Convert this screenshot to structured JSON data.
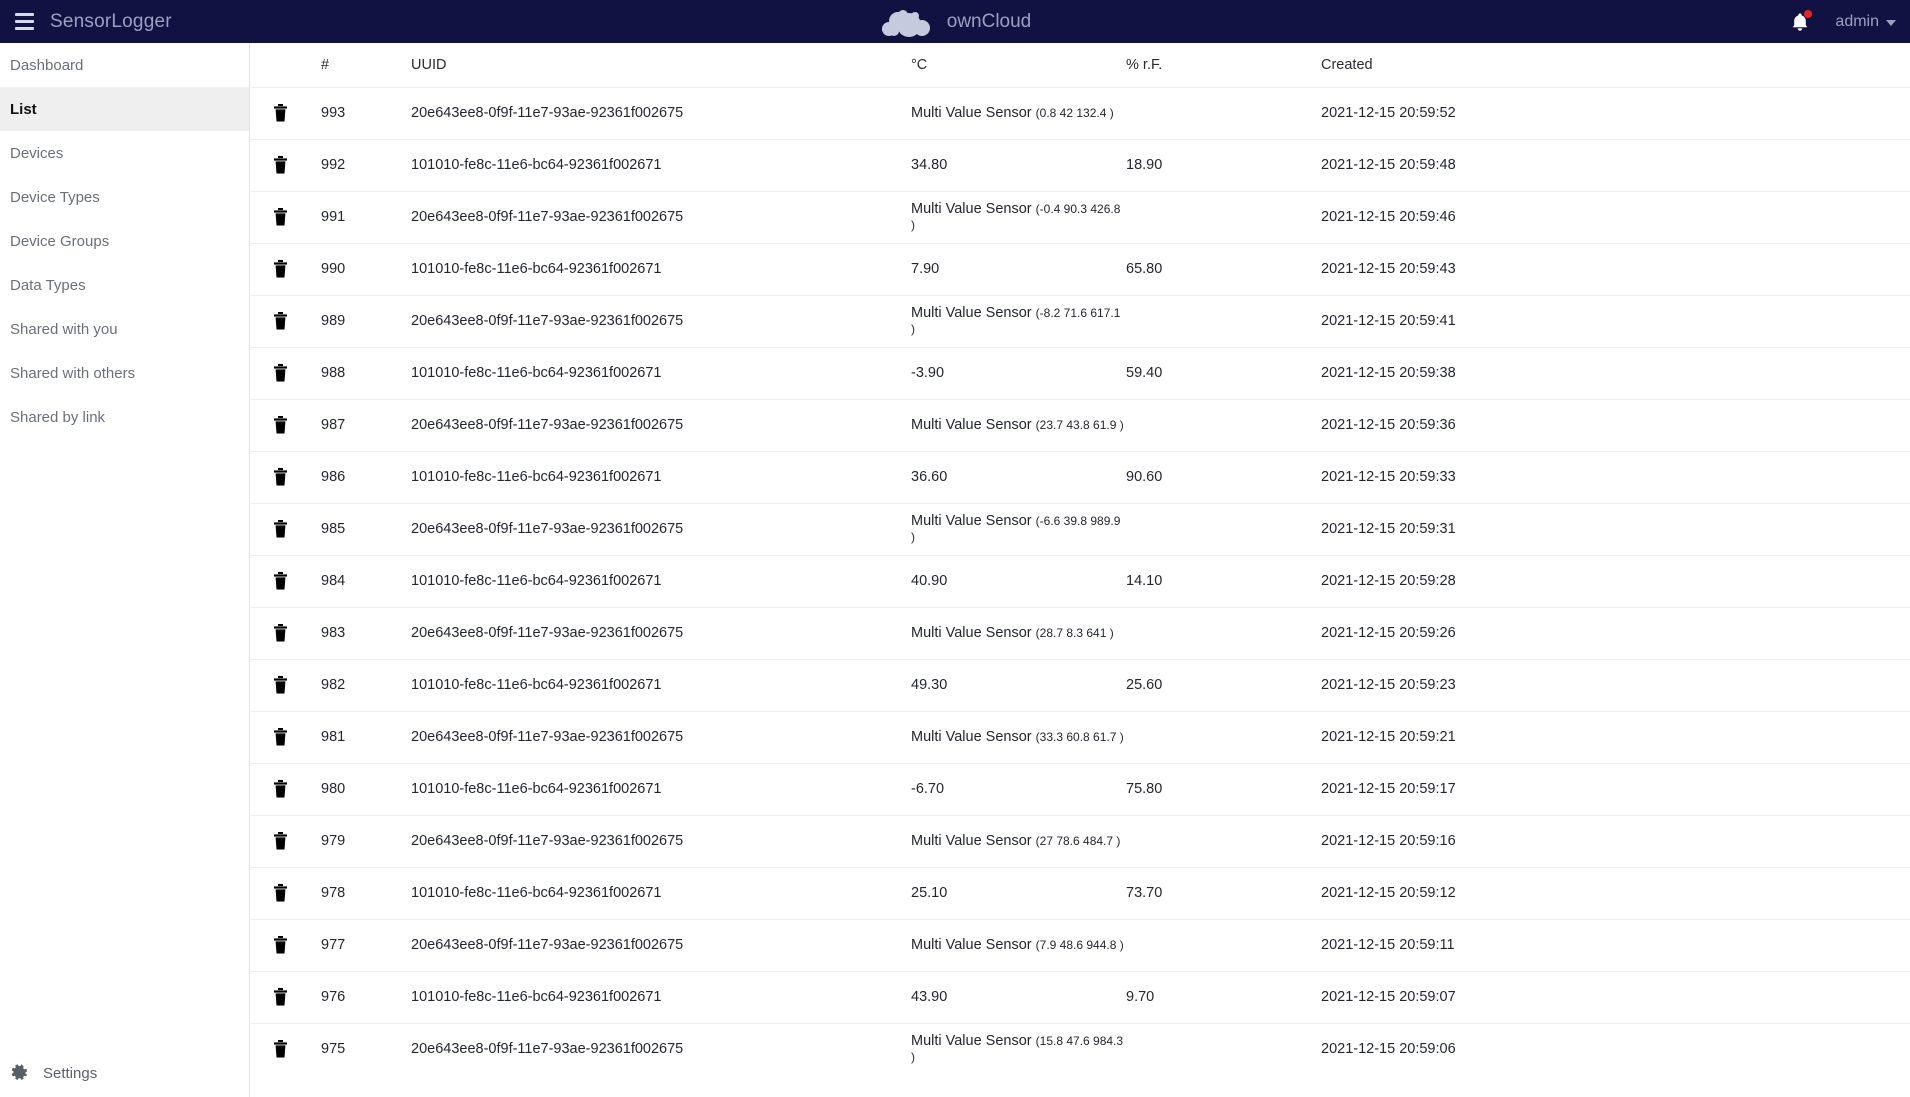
{
  "topbar": {
    "menu_icon": "hamburger-icon",
    "app_title": "SensorLogger",
    "brand": "ownCloud",
    "brand_logo_icon": "owncloud-cloud-logo",
    "notification_icon": "bell-icon",
    "user_name": "admin",
    "caret_icon": "chevron-down-icon"
  },
  "sidebar": {
    "items": [
      {
        "label": "Dashboard",
        "active": false
      },
      {
        "label": "List",
        "active": true
      },
      {
        "label": "Devices",
        "active": false
      },
      {
        "label": "Device Types",
        "active": false
      },
      {
        "label": "Device Groups",
        "active": false
      },
      {
        "label": "Data Types",
        "active": false
      },
      {
        "label": "Shared with you",
        "active": false
      },
      {
        "label": "Shared with others",
        "active": false
      },
      {
        "label": "Shared by link",
        "active": false
      }
    ],
    "settings": {
      "label": "Settings",
      "icon": "gear-icon"
    }
  },
  "table": {
    "columns": [
      "",
      "#",
      "UUID",
      "°C",
      "% r.F.",
      "Created"
    ],
    "delete_icon": "trash-icon",
    "multi_value_label": "Multi Value Sensor",
    "rows": [
      {
        "id": "993",
        "uuid": "20e643ee8-0f9f-11e7-93ae-92361f002675",
        "multi": true,
        "temp": "",
        "values": "(0.8 42 132.4 )",
        "hum": "",
        "created": "2021-12-15 20:59:52"
      },
      {
        "id": "992",
        "uuid": "101010-fe8c-11e6-bc64-92361f002671",
        "multi": false,
        "temp": "34.80",
        "values": "",
        "hum": "18.90",
        "created": "2021-12-15 20:59:48"
      },
      {
        "id": "991",
        "uuid": "20e643ee8-0f9f-11e7-93ae-92361f002675",
        "multi": true,
        "temp": "",
        "values": "(-0.4 90.3 426.8 )",
        "hum": "",
        "created": "2021-12-15 20:59:46"
      },
      {
        "id": "990",
        "uuid": "101010-fe8c-11e6-bc64-92361f002671",
        "multi": false,
        "temp": "7.90",
        "values": "",
        "hum": "65.80",
        "created": "2021-12-15 20:59:43"
      },
      {
        "id": "989",
        "uuid": "20e643ee8-0f9f-11e7-93ae-92361f002675",
        "multi": true,
        "temp": "",
        "values": "(-8.2 71.6 617.1 )",
        "hum": "",
        "created": "2021-12-15 20:59:41"
      },
      {
        "id": "988",
        "uuid": "101010-fe8c-11e6-bc64-92361f002671",
        "multi": false,
        "temp": "-3.90",
        "values": "",
        "hum": "59.40",
        "created": "2021-12-15 20:59:38"
      },
      {
        "id": "987",
        "uuid": "20e643ee8-0f9f-11e7-93ae-92361f002675",
        "multi": true,
        "temp": "",
        "values": "(23.7 43.8 61.9 )",
        "hum": "",
        "created": "2021-12-15 20:59:36"
      },
      {
        "id": "986",
        "uuid": "101010-fe8c-11e6-bc64-92361f002671",
        "multi": false,
        "temp": "36.60",
        "values": "",
        "hum": "90.60",
        "created": "2021-12-15 20:59:33"
      },
      {
        "id": "985",
        "uuid": "20e643ee8-0f9f-11e7-93ae-92361f002675",
        "multi": true,
        "temp": "",
        "values": "(-6.6 39.8 989.9 )",
        "hum": "",
        "created": "2021-12-15 20:59:31"
      },
      {
        "id": "984",
        "uuid": "101010-fe8c-11e6-bc64-92361f002671",
        "multi": false,
        "temp": "40.90",
        "values": "",
        "hum": "14.10",
        "created": "2021-12-15 20:59:28"
      },
      {
        "id": "983",
        "uuid": "20e643ee8-0f9f-11e7-93ae-92361f002675",
        "multi": true,
        "temp": "",
        "values": "(28.7 8.3 641 )",
        "hum": "",
        "created": "2021-12-15 20:59:26"
      },
      {
        "id": "982",
        "uuid": "101010-fe8c-11e6-bc64-92361f002671",
        "multi": false,
        "temp": "49.30",
        "values": "",
        "hum": "25.60",
        "created": "2021-12-15 20:59:23"
      },
      {
        "id": "981",
        "uuid": "20e643ee8-0f9f-11e7-93ae-92361f002675",
        "multi": true,
        "temp": "",
        "values": "(33.3 60.8 61.7 )",
        "hum": "",
        "created": "2021-12-15 20:59:21"
      },
      {
        "id": "980",
        "uuid": "101010-fe8c-11e6-bc64-92361f002671",
        "multi": false,
        "temp": "-6.70",
        "values": "",
        "hum": "75.80",
        "created": "2021-12-15 20:59:17"
      },
      {
        "id": "979",
        "uuid": "20e643ee8-0f9f-11e7-93ae-92361f002675",
        "multi": true,
        "temp": "",
        "values": "(27 78.6 484.7 )",
        "hum": "",
        "created": "2021-12-15 20:59:16"
      },
      {
        "id": "978",
        "uuid": "101010-fe8c-11e6-bc64-92361f002671",
        "multi": false,
        "temp": "25.10",
        "values": "",
        "hum": "73.70",
        "created": "2021-12-15 20:59:12"
      },
      {
        "id": "977",
        "uuid": "20e643ee8-0f9f-11e7-93ae-92361f002675",
        "multi": true,
        "temp": "",
        "values": "(7.9 48.6 944.8 )",
        "hum": "",
        "created": "2021-12-15 20:59:11"
      },
      {
        "id": "976",
        "uuid": "101010-fe8c-11e6-bc64-92361f002671",
        "multi": false,
        "temp": "43.90",
        "values": "",
        "hum": "9.70",
        "created": "2021-12-15 20:59:07"
      },
      {
        "id": "975",
        "uuid": "20e643ee8-0f9f-11e7-93ae-92361f002675",
        "multi": true,
        "temp": "",
        "values": "(15.8 47.6 984.3 )",
        "hum": "",
        "created": "2021-12-15 20:59:06"
      }
    ]
  },
  "colors": {
    "topbar_bg": "#121242",
    "topbar_text": "#9aa0c0",
    "active_nav_bg": "#efefef",
    "notification_dot": "#e8241b",
    "row_border": "#eceef0"
  }
}
